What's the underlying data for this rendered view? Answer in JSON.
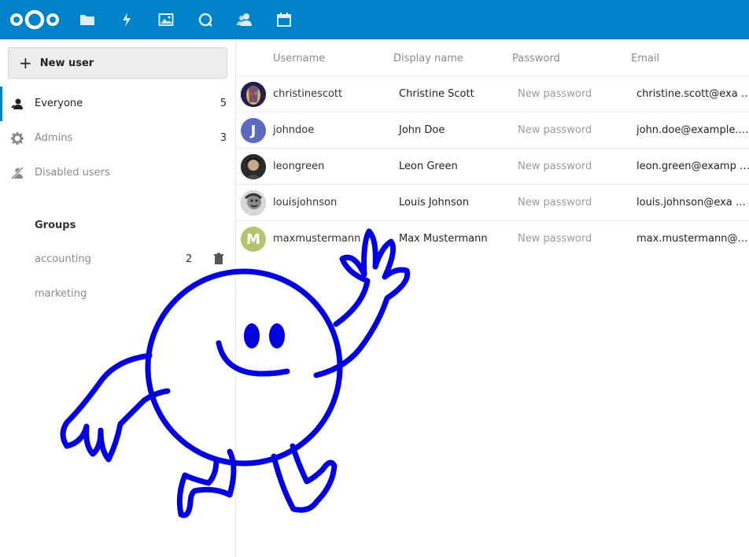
{
  "header": {
    "brand_color": "#0082c9",
    "logo": "nextcloud-logo",
    "apps": [
      {
        "name": "files",
        "icon": "folder-icon"
      },
      {
        "name": "activity",
        "icon": "lightning-icon"
      },
      {
        "name": "gallery",
        "icon": "image-icon"
      },
      {
        "name": "search",
        "icon": "search-icon"
      },
      {
        "name": "contacts",
        "icon": "contacts-icon"
      },
      {
        "name": "calendar",
        "icon": "calendar-icon"
      }
    ]
  },
  "sidebar": {
    "new_user_label": "New user",
    "items": [
      {
        "label": "Everyone",
        "count": "5",
        "icon": "user-icon"
      },
      {
        "label": "Admins",
        "count": "3",
        "icon": "gear-icon"
      },
      {
        "label": "Disabled users",
        "count": "",
        "icon": "disabled-user-icon"
      }
    ],
    "groups_heading": "Groups",
    "groups": [
      {
        "label": "accounting",
        "count": "2"
      },
      {
        "label": "marketing",
        "count": ""
      }
    ]
  },
  "table": {
    "headers": {
      "username": "Username",
      "display_name": "Display name",
      "password": "Password",
      "email": "Email"
    },
    "rows": [
      {
        "username": "christinescott",
        "display_name": "Christine Scott",
        "password": "New password",
        "email": "christine.scott@exa …",
        "avatar": "photo",
        "avatar_color": "#3a3a6a"
      },
      {
        "username": "johndoe",
        "display_name": "John Doe",
        "password": "New password",
        "email": "john.doe@example.…",
        "avatar": "J",
        "avatar_color": "#5b6abf"
      },
      {
        "username": "leongreen",
        "display_name": "Leon Green",
        "password": "New password",
        "email": "leon.green@examp …",
        "avatar": "photo",
        "avatar_color": "#2a2a2a"
      },
      {
        "username": "louisjohnson",
        "display_name": "Louis Johnson",
        "password": "New password",
        "email": "louis.johnson@exa …",
        "avatar": "photo",
        "avatar_color": "#555555"
      },
      {
        "username": "maxmustermann",
        "display_name": "Max Mustermann",
        "password": "New password",
        "email": "max.mustermann@…",
        "avatar": "M",
        "avatar_color": "#b5c46f"
      }
    ]
  },
  "doodle": {
    "color": "#0000e0",
    "subject": "waving-smiley-character"
  }
}
